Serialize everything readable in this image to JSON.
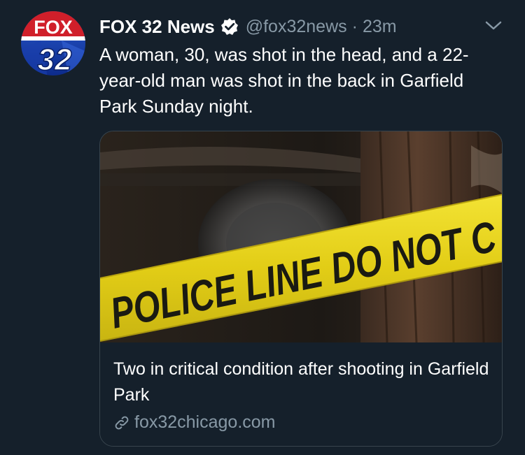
{
  "tweet": {
    "display_name": "FOX 32 News",
    "handle": "@fox32news",
    "separator": "·",
    "time": "23m",
    "verified": true,
    "text": "A woman, 30, was shot in the head, and a 22-year-old man was shot in the back in Garfield Park Sunday night.",
    "avatar": {
      "logo_text_top": "FOX",
      "logo_text_bottom": "32",
      "icon": "fox32-logo"
    },
    "menu_icon": "chevron-down-icon"
  },
  "card": {
    "title": "Two in critical condition after shooting in Garfield Park",
    "domain": "fox32chicago.com",
    "link_icon": "link-icon",
    "image": {
      "description_icon": "police-tape-image",
      "tape_text": "POLICE LINE DO NOT C"
    }
  },
  "colors": {
    "background": "#15202b",
    "text_primary": "#ffffff",
    "text_secondary": "#8899a6",
    "border": "#38444d",
    "tape_yellow": "#e6d31a"
  }
}
